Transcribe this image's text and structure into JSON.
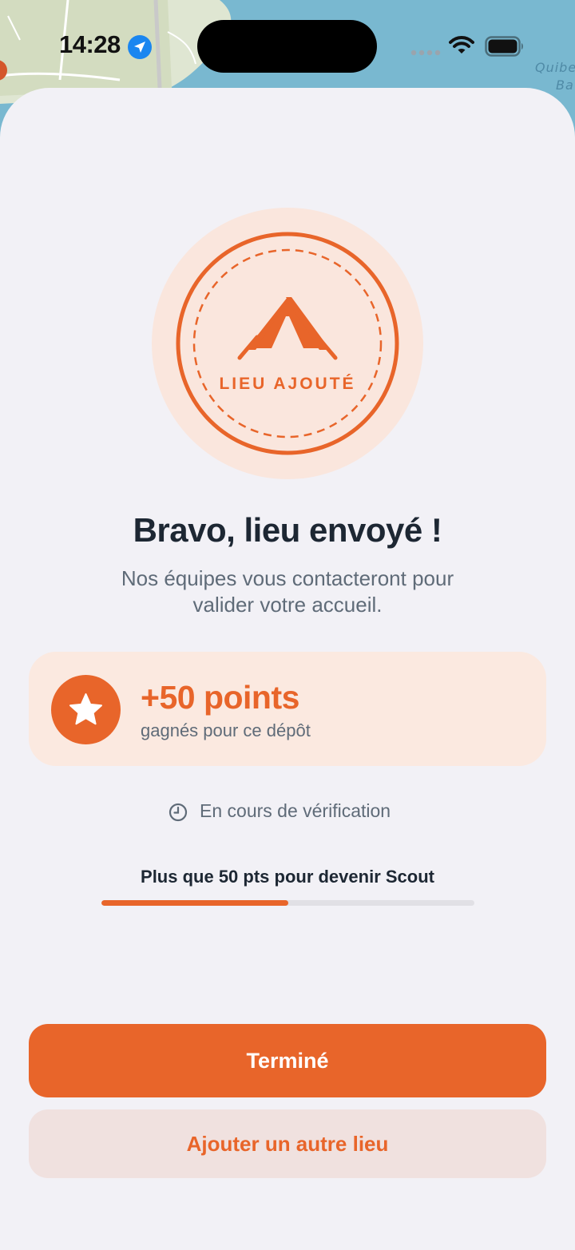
{
  "status_bar": {
    "time": "14:28",
    "icons": [
      "location-arrow-icon",
      "cellular-signal-icon",
      "wifi-icon",
      "battery-icon"
    ]
  },
  "map": {
    "label_line1": "Quibe",
    "label_line2": "Ba"
  },
  "badge": {
    "icon": "tent-icon",
    "label": "LIEU AJOUTÉ"
  },
  "main": {
    "title": "Bravo, lieu envoyé !",
    "subtitle": "Nos équipes vous contacteront pour valider votre accueil."
  },
  "points_card": {
    "icon": "star-icon",
    "value": "+50 points",
    "description": "gagnés pour ce dépôt"
  },
  "verification": {
    "icon": "clock-icon",
    "text": "En cours de vérification"
  },
  "progress": {
    "label": "Plus que 50 pts pour devenir Scout",
    "fraction": 0.5
  },
  "buttons": {
    "primary_label": "Terminé",
    "secondary_label": "Ajouter un autre lieu"
  },
  "colors": {
    "accent": "#e8652a",
    "accent_light": "#fae6dd",
    "background": "#f2f1f6",
    "title_text": "#1d2733",
    "secondary_text": "#5f6b78"
  }
}
